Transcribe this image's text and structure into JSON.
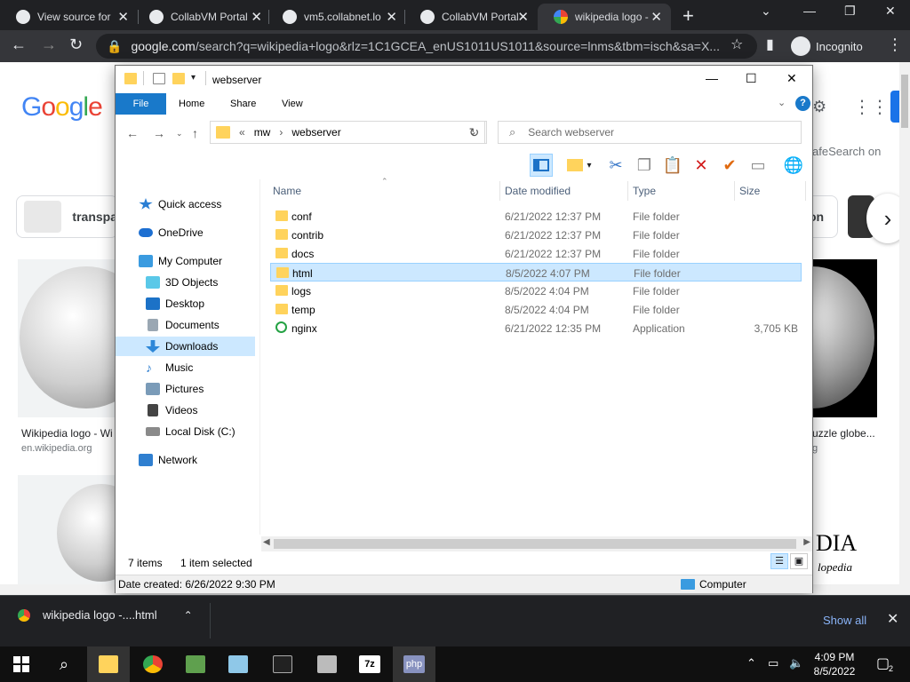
{
  "chrome": {
    "tabs": [
      {
        "title": "View source for",
        "active": false
      },
      {
        "title": "CollabVM Portal",
        "active": false
      },
      {
        "title": "vm5.collabnet.lo",
        "active": false
      },
      {
        "title": "CollabVM Portal",
        "active": false
      },
      {
        "title": "wikipedia logo -",
        "active": true
      }
    ],
    "url_host": "google.com",
    "url_path": "/search?q=wikipedia+logo&rlz=1C1GCEA_enUS1011US1011&source=lnms&tbm=isch&sa=X...",
    "incognito_label": "Incognito"
  },
  "google": {
    "logo": "Google",
    "safesearch": "afeSearch on",
    "chip_left": "transpa",
    "chip_right": "on",
    "caption_left": "Wikipedia logo - Wi",
    "source_left": "en.wikipedia.org",
    "caption_right": "uzzle globe...",
    "source_right": "g",
    "partial_text": "DIA",
    "partial_sub": "lopedia"
  },
  "explorer": {
    "title": "webserver",
    "ribbon_tabs": [
      "File",
      "Home",
      "Share",
      "View"
    ],
    "address": [
      "mw",
      "webserver"
    ],
    "search_placeholder": "Search webserver",
    "nav": [
      {
        "label": "Quick access",
        "color": "#2b7fd4"
      },
      {
        "label": "OneDrive",
        "color": "#1d6fd1"
      },
      {
        "label": "My Computer",
        "color": "#3a9be0"
      },
      {
        "label": "3D Objects",
        "color": "#5ac8e8"
      },
      {
        "label": "Desktop",
        "color": "#1c72c7"
      },
      {
        "label": "Documents",
        "color": "#9aa7b3"
      },
      {
        "label": "Downloads",
        "color": "#2d87d8"
      },
      {
        "label": "Music",
        "color": "#2f7fd0"
      },
      {
        "label": "Pictures",
        "color": "#7a9bb8"
      },
      {
        "label": "Videos",
        "color": "#444444"
      },
      {
        "label": "Local Disk (C:)",
        "color": "#8a8a8a"
      },
      {
        "label": "Network",
        "color": "#2f7fd0"
      }
    ],
    "columns": [
      "Name",
      "Date modified",
      "Type",
      "Size"
    ],
    "files": [
      {
        "name": "conf",
        "date": "6/21/2022 12:37 PM",
        "type": "File folder",
        "size": ""
      },
      {
        "name": "contrib",
        "date": "6/21/2022 12:37 PM",
        "type": "File folder",
        "size": ""
      },
      {
        "name": "docs",
        "date": "6/21/2022 12:37 PM",
        "type": "File folder",
        "size": ""
      },
      {
        "name": "html",
        "date": "8/5/2022 4:07 PM",
        "type": "File folder",
        "size": ""
      },
      {
        "name": "logs",
        "date": "8/5/2022 4:04 PM",
        "type": "File folder",
        "size": ""
      },
      {
        "name": "temp",
        "date": "8/5/2022 4:04 PM",
        "type": "File folder",
        "size": ""
      },
      {
        "name": "nginx",
        "date": "6/21/2022 12:35 PM",
        "type": "Application",
        "size": "3,705 KB"
      }
    ],
    "item_count": "7 items",
    "selection": "1 item selected",
    "date_created": "Date created: 6/26/2022 9:30 PM",
    "computer_label": "Computer"
  },
  "download": {
    "filename": "wikipedia logo -....html",
    "show_all": "Show all"
  },
  "taskbar": {
    "time": "4:09 PM",
    "date": "8/5/2022",
    "notifications": "2"
  }
}
